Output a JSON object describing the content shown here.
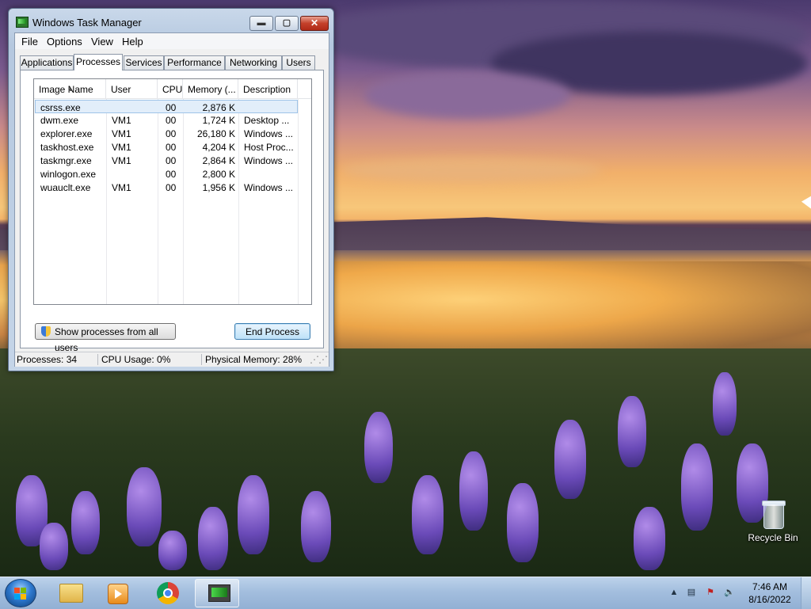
{
  "window": {
    "title": "Windows Task Manager",
    "controls": {
      "minimize": "▬",
      "maximize": "▢",
      "close": "✕"
    }
  },
  "menu": [
    "File",
    "Options",
    "View",
    "Help"
  ],
  "tabs": [
    "Applications",
    "Processes",
    "Services",
    "Performance",
    "Networking",
    "Users"
  ],
  "active_tab": "Processes",
  "columns": [
    "Image Name",
    "User Name",
    "CPU",
    "Memory (...",
    "Description"
  ],
  "processes": [
    {
      "image": "csrss.exe",
      "user": "",
      "cpu": "00",
      "memory": "2,876 K",
      "description": ""
    },
    {
      "image": "dwm.exe",
      "user": "VM1",
      "cpu": "00",
      "memory": "1,724 K",
      "description": "Desktop ..."
    },
    {
      "image": "explorer.exe",
      "user": "VM1",
      "cpu": "00",
      "memory": "26,180 K",
      "description": "Windows ..."
    },
    {
      "image": "taskhost.exe",
      "user": "VM1",
      "cpu": "00",
      "memory": "4,204 K",
      "description": "Host Proc..."
    },
    {
      "image": "taskmgr.exe",
      "user": "VM1",
      "cpu": "00",
      "memory": "2,864 K",
      "description": "Windows ..."
    },
    {
      "image": "winlogon.exe",
      "user": "",
      "cpu": "00",
      "memory": "2,800 K",
      "description": ""
    },
    {
      "image": "wuauclt.exe",
      "user": "VM1",
      "cpu": "00",
      "memory": "1,956 K",
      "description": "Windows ..."
    }
  ],
  "buttons": {
    "show_all": "Show processes from all users",
    "end_process": "End Process"
  },
  "status": {
    "processes": "Processes: 34",
    "cpu": "CPU Usage: 0%",
    "memory": "Physical Memory: 28%"
  },
  "desktop": {
    "recycle_bin": "Recycle Bin"
  },
  "taskbar": {
    "icons": [
      "start-orb-icon",
      "windows-explorer-icon",
      "media-player-icon",
      "chrome-icon",
      "task-manager-icon"
    ],
    "tray_icons": [
      "show-hidden-icons-chevron",
      "network-icon",
      "action-center-flag-icon",
      "volume-icon"
    ]
  },
  "clock": {
    "time": "7:46 AM",
    "date": "8/16/2022"
  }
}
